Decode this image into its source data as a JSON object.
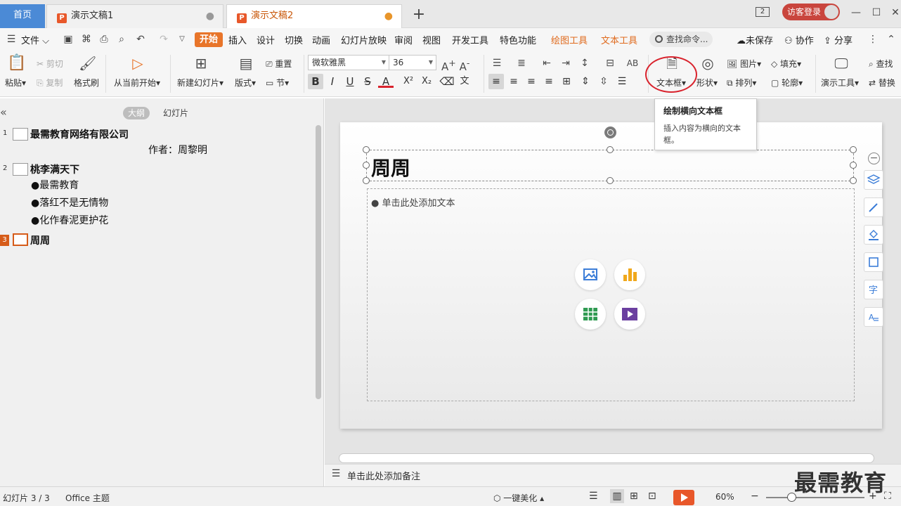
{
  "tabs": {
    "home": "首页",
    "doc1": "演示文稿1",
    "doc2": "演示文稿2",
    "dot": "●",
    "add": "+"
  },
  "window": {
    "counter": "2",
    "login": "访客登录"
  },
  "menu": {
    "file": "文件",
    "start": "开始",
    "insert": "插入",
    "design": "设计",
    "transition": "切换",
    "animation": "动画",
    "slideshow": "幻灯片放映",
    "review": "审阅",
    "view": "视图",
    "developer": "开发工具",
    "special": "特色功能",
    "drawing_tools": "绘图工具",
    "text_tools": "文本工具",
    "search_placeholder": "查找命令...",
    "unsaved": "未保存",
    "collab": "协作",
    "share": "分享"
  },
  "ribbon": {
    "paste": "粘贴",
    "cut": "剪切",
    "copy": "复制",
    "format_painter": "格式刷",
    "from_current": "从当前开始",
    "new_slide": "新建幻灯片",
    "layout": "版式",
    "reset": "重置",
    "section": "节",
    "font_name": "微软雅黑",
    "font_size": "36",
    "textbox": "文本框",
    "shape": "形状",
    "picture": "图片",
    "fill": "填充",
    "arrange": "排列",
    "outline": "轮廓",
    "present_tools": "演示工具",
    "find": "查找",
    "replace": "替换"
  },
  "tooltip": {
    "title": "绘制横向文本框",
    "desc": "插入内容为横向的文本框。"
  },
  "left_panel": {
    "tab_outline": "大纲",
    "tab_slides": "幻灯片",
    "outline": [
      {
        "num": "1",
        "title": "最需教育网络有限公司",
        "subs": [
          "作者：周黎明"
        ]
      },
      {
        "num": "2",
        "title": "桃李满天下",
        "subs": [
          "●最需教育",
          "●落红不是无情物",
          "●化作春泥更护花"
        ]
      },
      {
        "num": "3",
        "title": "周周",
        "subs": []
      }
    ]
  },
  "slide": {
    "title": "周周",
    "content_placeholder": "● 单击此处添加文本"
  },
  "notes": {
    "placeholder": "单击此处添加备注"
  },
  "status": {
    "slide_pos": "幻灯片 3 / 3",
    "theme": "Office 主题",
    "beautify": "一键美化",
    "zoom": "60%",
    "watermark": "最需教育"
  },
  "colors": {
    "accent_orange": "#e8752a",
    "home_tab_blue": "#4b8ad6",
    "login_red": "#c9453d",
    "highlight_red": "#d9232d",
    "active_outline": "#d65c1a"
  }
}
